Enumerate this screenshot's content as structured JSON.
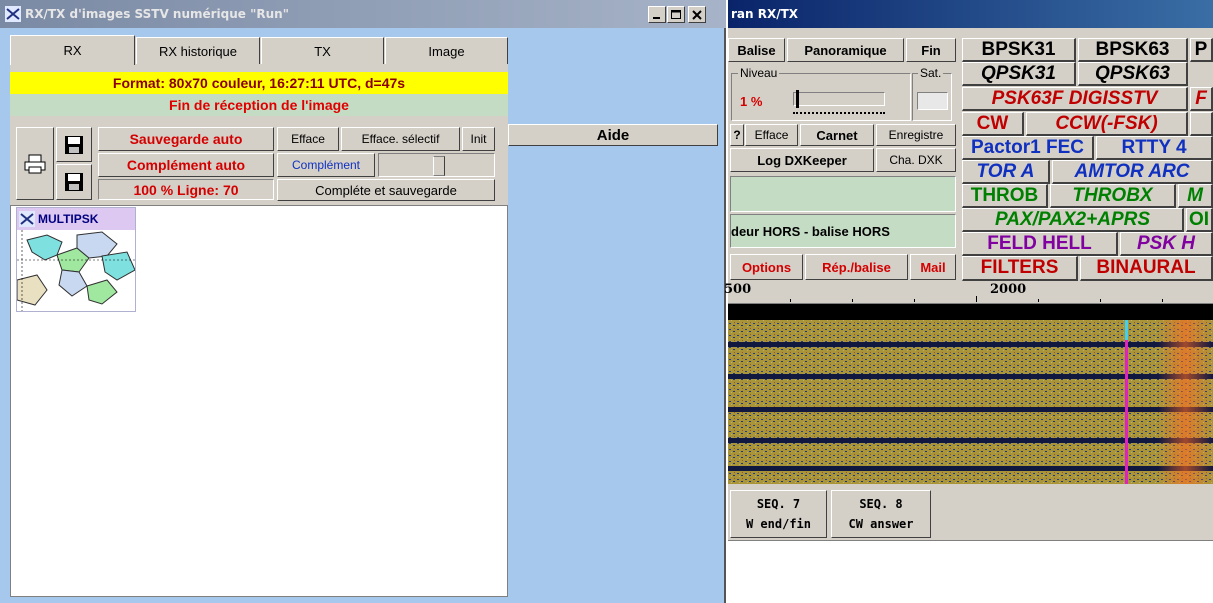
{
  "left_window": {
    "title": "RX/TX d'images SSTV numérique \"Run\"",
    "tabs": [
      {
        "label": "RX"
      },
      {
        "label": "RX historique"
      },
      {
        "label": "TX"
      },
      {
        "label": "Image"
      }
    ],
    "format_line": "Format: 80x70 couleur,  16:27:11 UTC, d=47s",
    "status_line": "Fin de réception de l'image",
    "buttons": {
      "sauvegarde_auto": "Sauvegarde auto",
      "efface": "Efface",
      "efface_selectif": "Efface. sélectif",
      "init": "Init",
      "complement_auto": "Complément auto",
      "complement": "Complément",
      "completer_sauvegarde": "Compléte et sauvegarde",
      "aide": "Aide"
    },
    "progress_text": "100 %  Ligne: 70",
    "image_label": "MULTIPSK"
  },
  "right_window": {
    "title": "ran RX/TX",
    "menu": [
      "Balise",
      "Panoramique",
      "Fin"
    ],
    "niveau_label": "Niveau",
    "niveau_value": "1 %",
    "sat_label": "Sat.",
    "row_buttons1": [
      "?",
      "Efface",
      "Carnet",
      "Enregistre"
    ],
    "row_buttons2": [
      "Log DXKeeper",
      "Cha. DXK"
    ],
    "status_text": "deur HORS - balise HORS",
    "bottom_buttons": [
      "Options",
      "Rép./balise",
      "Mail"
    ],
    "freq_ticks": [
      "500",
      "2000"
    ],
    "modes": [
      {
        "label": "BPSK31",
        "color": "#000000"
      },
      {
        "label": "BPSK63",
        "color": "#000000"
      },
      {
        "label": "P",
        "color": "#000000"
      },
      {
        "label": "QPSK31",
        "color": "#000000"
      },
      {
        "label": "QPSK63",
        "color": "#000000"
      },
      {
        "label": "PSK63F DIGISSTV",
        "color": "#c00000"
      },
      {
        "label": "F",
        "color": "#c00000"
      },
      {
        "label": "CW",
        "color": "#c00000"
      },
      {
        "label": "CCW(-FSK)",
        "color": "#c00000"
      },
      {
        "label": "Pactor1 FEC",
        "color": "#1030c0"
      },
      {
        "label": "RTTY 4",
        "color": "#1030c0"
      },
      {
        "label": "TOR A",
        "color": "#1030c0"
      },
      {
        "label": "AMTOR ARC",
        "color": "#1030c0"
      },
      {
        "label": "THROB",
        "color": "#008000"
      },
      {
        "label": "THROBX",
        "color": "#008000"
      },
      {
        "label": "M",
        "color": "#008000"
      },
      {
        "label": "PAX/PAX2+APRS",
        "color": "#008000"
      },
      {
        "label": "OI",
        "color": "#008000"
      },
      {
        "label": "FELD HELL",
        "color": "#8000a0"
      },
      {
        "label": "PSK H",
        "color": "#8000a0"
      },
      {
        "label": "FILTERS",
        "color": "#c00000"
      },
      {
        "label": "BINAURAL",
        "color": "#c00000"
      }
    ],
    "seq": [
      {
        "label": "SEQ. 7",
        "sub": "W end/fin"
      },
      {
        "label": "SEQ. 8",
        "sub": "CW answer"
      }
    ]
  }
}
